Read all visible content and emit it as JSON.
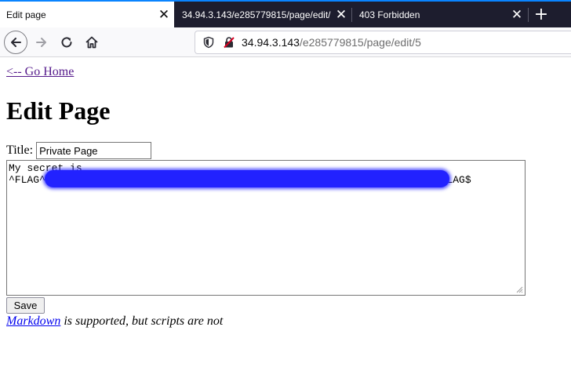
{
  "browser": {
    "tabs": [
      {
        "title": "Edit page",
        "active": true
      },
      {
        "title": "34.94.3.143/e285779815/page/edit/",
        "active": false
      },
      {
        "title": "403 Forbidden",
        "active": false
      }
    ],
    "url_host": "34.94.3.143",
    "url_path": "/e285779815/page/edit/5",
    "icons": [
      "back-arrow-icon",
      "forward-arrow-icon",
      "reload-icon",
      "home-icon",
      "shield-icon",
      "insecure-lock-icon",
      "close-icon",
      "plus-icon"
    ]
  },
  "page": {
    "home_link": "<-- Go Home",
    "heading": "Edit Page",
    "title_label": "Title:",
    "title_value": "Private Page",
    "content_line1": "My secret is",
    "content_line2_start": "^FLAG^",
    "content_line2_end": "$FLAG$",
    "save_label": "Save",
    "note_link": "Markdown",
    "note_rest": " is supported, but scripts are not"
  },
  "colors": {
    "tabstrip": "#1d1d2e",
    "accent": "#0a84ff",
    "redaction": "#2222ff",
    "link_visited": "#551a8b",
    "link": "#0000ee"
  }
}
